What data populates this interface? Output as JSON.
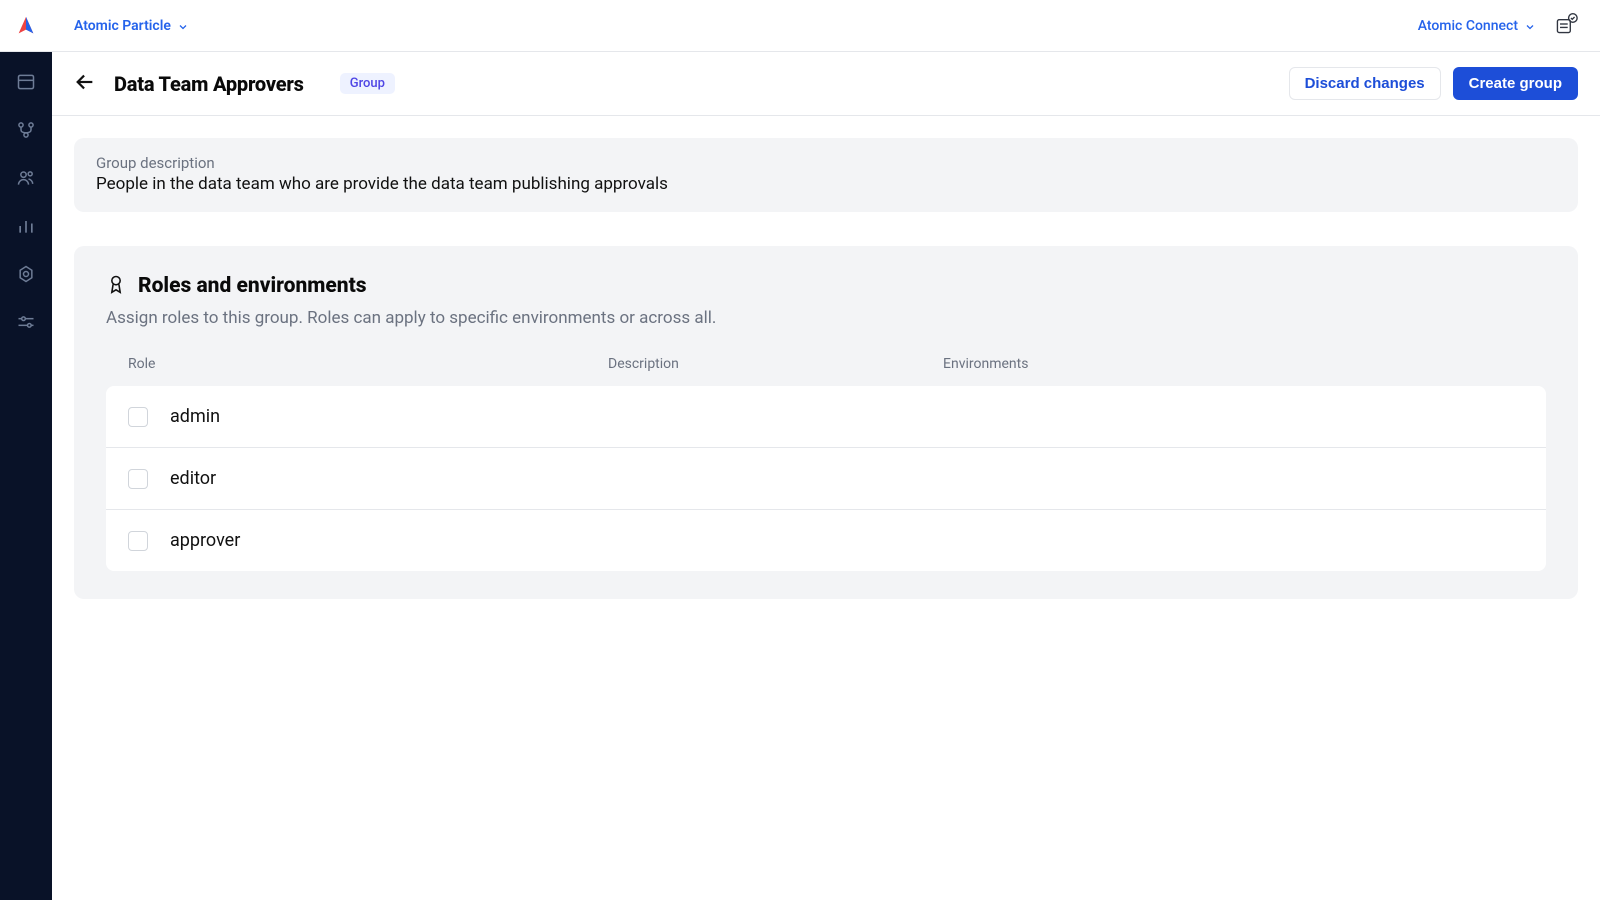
{
  "topbar": {
    "workspace": "Atomic Particle",
    "right_link": "Atomic Connect"
  },
  "page": {
    "title": "Data Team Approvers",
    "badge": "Group",
    "discard_label": "Discard changes",
    "create_label": "Create group"
  },
  "description": {
    "label": "Group description",
    "text": "People in the data team who are provide the data team publishing approvals"
  },
  "roles": {
    "title": "Roles and environments",
    "subtitle": "Assign roles to this group. Roles can apply to specific environments or across all.",
    "columns": {
      "role": "Role",
      "description": "Description",
      "environments": "Environments"
    },
    "items": [
      {
        "name": "admin"
      },
      {
        "name": "editor"
      },
      {
        "name": "approver"
      }
    ]
  }
}
